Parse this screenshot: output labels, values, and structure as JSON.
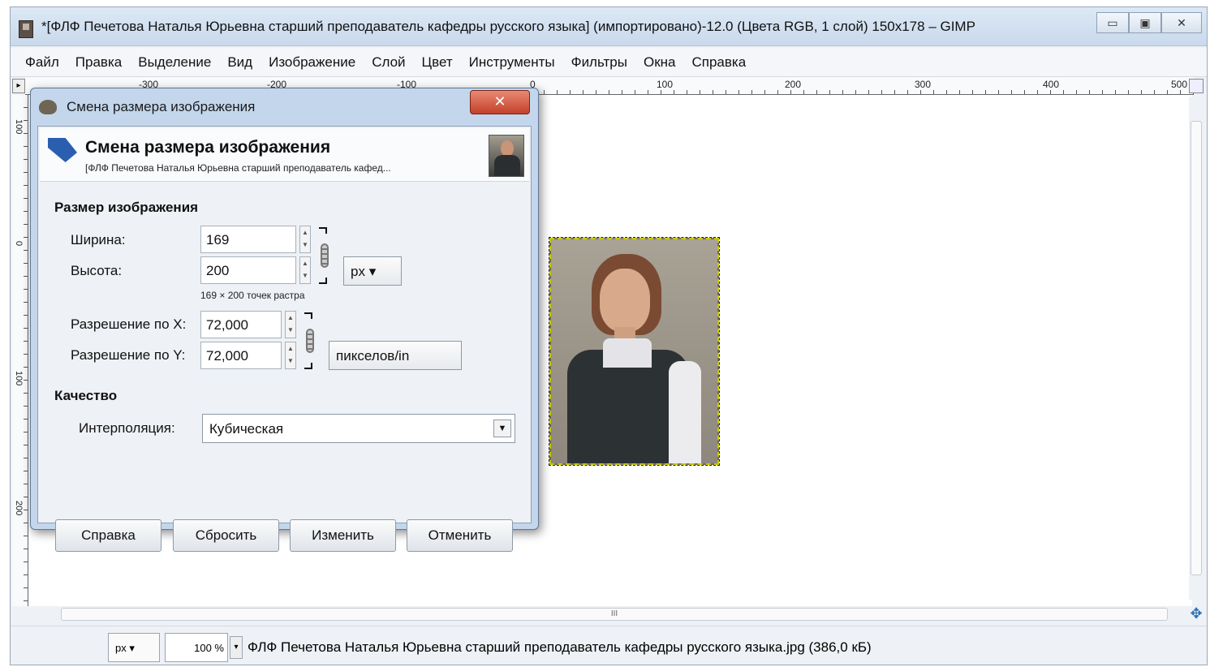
{
  "window": {
    "title": "*[ФЛФ Печетова Наталья Юрьевна старший преподаватель кафедры русского языка] (импортировано)-12.0 (Цвета RGB, 1 слой) 150x178 – GIMP",
    "buttons": {
      "minimize": "▭",
      "maximize": "▣",
      "close": "✕"
    }
  },
  "menubar": {
    "items": [
      "Файл",
      "Правка",
      "Выделение",
      "Вид",
      "Изображение",
      "Слой",
      "Цвет",
      "Инструменты",
      "Фильтры",
      "Окна",
      "Справка"
    ]
  },
  "ruler": {
    "top_labels": [
      "-300",
      "-200",
      "-100",
      "0",
      "100",
      "200",
      "300",
      "400",
      "500"
    ],
    "left_labels": [
      "100",
      "0",
      "100",
      "200"
    ]
  },
  "dialog": {
    "title": "Смена размера изображения",
    "close_glyph": "✕",
    "header": {
      "title": "Смена размера изображения",
      "subtitle": "[ФЛФ Печетова Наталья Юрьевна старший преподаватель кафед..."
    },
    "size_section": "Размер изображения",
    "width_label": "Ширина:",
    "width_value": "169",
    "height_label": "Высота:",
    "height_value": "200",
    "size_unit": "px",
    "size_note": "169 × 200 точек растра",
    "res_x_label": "Разрешение по X:",
    "res_x_value": "72,000",
    "res_y_label": "Разрешение по Y:",
    "res_y_value": "72,000",
    "res_unit": "пикселов/in",
    "quality_section": "Качество",
    "interp_label": "Интерполяция:",
    "interp_value": "Кубическая",
    "buttons": {
      "help": "Справка",
      "reset": "Сбросить",
      "resize": "Изменить",
      "cancel": "Отменить"
    }
  },
  "statusbar": {
    "unit": "px",
    "zoom": "100 %",
    "file_info": "ФЛФ Печетова Наталья Юрьевна старший преподаватель кафедры русского языка.jpg (386,0 кБ)"
  },
  "scrollbar": {
    "grip": "III"
  }
}
